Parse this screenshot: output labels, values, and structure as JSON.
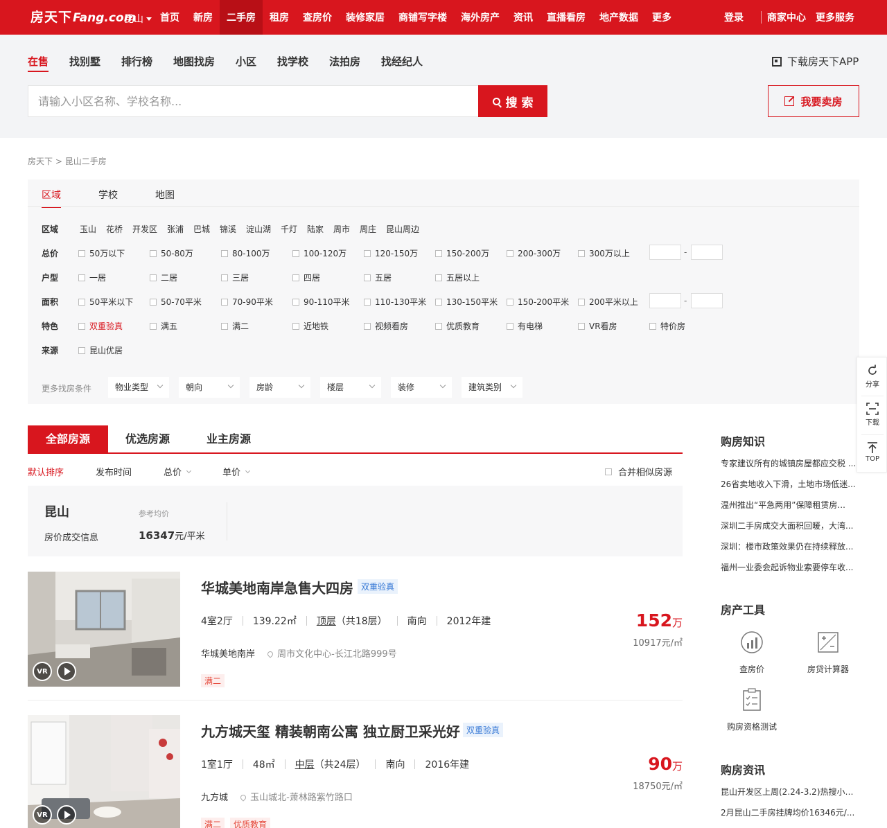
{
  "brand": {
    "logo_cn": "房天下",
    "logo_en": "Fang.com",
    "accent": "#d8161e"
  },
  "topnav": {
    "city": "昆山",
    "items": [
      "首页",
      "新房",
      "二手房",
      "租房",
      "查房价",
      "装修家居",
      "商铺写字楼",
      "海外房产",
      "资讯",
      "直播看房",
      "地产数据",
      "更多"
    ],
    "active": "二手房",
    "right": [
      "登录",
      "商家中心",
      "更多服务"
    ]
  },
  "subnav": {
    "tabs": [
      "在售",
      "找别墅",
      "排行榜",
      "地图找房",
      "小区",
      "找学校",
      "法拍房",
      "找经纪人"
    ],
    "app_download": "下载房天下APP",
    "search_placeholder": "请输入小区名称、学校名称...",
    "search_button": "搜 索",
    "sell_button": "我要卖房"
  },
  "breadcrumb": [
    "房天下",
    ">",
    "昆山二手房"
  ],
  "filters": {
    "tabs": [
      "区域",
      "学校",
      "地图"
    ],
    "rows": [
      {
        "label": "区域",
        "options": [
          "玉山",
          "花桥",
          "开发区",
          "张浦",
          "巴城",
          "锦溪",
          "淀山湖",
          "千灯",
          "陆家",
          "周市",
          "周庄",
          "昆山周边"
        ]
      },
      {
        "label": "总价",
        "options": [
          "50万以下",
          "50-80万",
          "80-100万",
          "100-120万",
          "120-150万",
          "150-200万",
          "200-300万",
          "300万以上"
        ]
      },
      {
        "label": "户型",
        "options": [
          "一居",
          "二居",
          "三居",
          "四居",
          "五居",
          "五居以上"
        ]
      },
      {
        "label": "面积",
        "options": [
          "50平米以下",
          "50-70平米",
          "70-90平米",
          "90-110平米",
          "110-130平米",
          "130-150平米",
          "150-200平米",
          "200平米以上"
        ]
      },
      {
        "label": "特色",
        "options": [
          "双重验真",
          "满五",
          "满二",
          "近地铁",
          "视频看房",
          "优质教育",
          "有电梯",
          "VR看房",
          "特价房"
        ]
      },
      {
        "label": "来源",
        "options": [
          "昆山优居"
        ]
      }
    ],
    "range_dash": "-",
    "more_label": "更多找房条件",
    "dropdowns": [
      "物业类型",
      "朝向",
      "房龄",
      "楼层",
      "装修",
      "建筑类别"
    ]
  },
  "list": {
    "tabs": [
      "全部房源",
      "优选房源",
      "业主房源"
    ],
    "sort": [
      "默认排序",
      "发布时间",
      "总价",
      "单价"
    ],
    "merge_label": "合并相似房源",
    "price_info": {
      "city": "昆山",
      "sub": "房价成交信息",
      "ref_label": "参考均价",
      "value": "16347",
      "unit": "元/平米"
    },
    "listings": [
      {
        "title": "华城美地南岸急售大四房",
        "badge": "双重验真",
        "layout": "4室2厅",
        "area": "139.22㎡",
        "floor": "顶层",
        "floor_total": "（共18层）",
        "facing": "南向",
        "year": "2012年建",
        "community": "华城美地南岸",
        "address": "周市文化中心-长江北路999号",
        "tags": [
          "满二"
        ],
        "price": "152",
        "price_unit": "万",
        "unit_price": "10917元/㎡",
        "vr": "VR"
      },
      {
        "title": "九方城天玺 精装朝南公寓 独立厨卫采光好",
        "badge": "双重验真",
        "layout": "1室1厅",
        "area": "48㎡",
        "floor": "中层",
        "floor_total": "（共24层）",
        "facing": "南向",
        "year": "2016年建",
        "community": "九方城",
        "address": "玉山城北-萧林路紫竹路口",
        "tags": [
          "满二",
          "优质教育"
        ],
        "price": "90",
        "price_unit": "万",
        "unit_price": "18750元/㎡",
        "vr": "VR"
      }
    ]
  },
  "sidebar": {
    "knowledge_title": "购房知识",
    "knowledge": [
      "专家建议所有的城镇房屋都应交税 ...",
      "26省卖地收入下滑，土地市场低迷...",
      "温州推出“平急两用”保障租赁房...",
      "深圳二手房成交大面积回暖，大湾...",
      "深圳：楼市政策效果仍在持续释放...",
      "福州一业委会起诉物业索要停车收..."
    ],
    "tools_title": "房产工具",
    "tools": [
      "查房价",
      "房贷计算器",
      "购房资格测试"
    ],
    "news_title": "购房资讯",
    "news": [
      "昆山开发区上周(2.24-3.2)热搜小区...",
      "2月昆山二手房挂牌均价16346元/..."
    ]
  },
  "floatbar": [
    "分享",
    "下载",
    "TOP"
  ]
}
